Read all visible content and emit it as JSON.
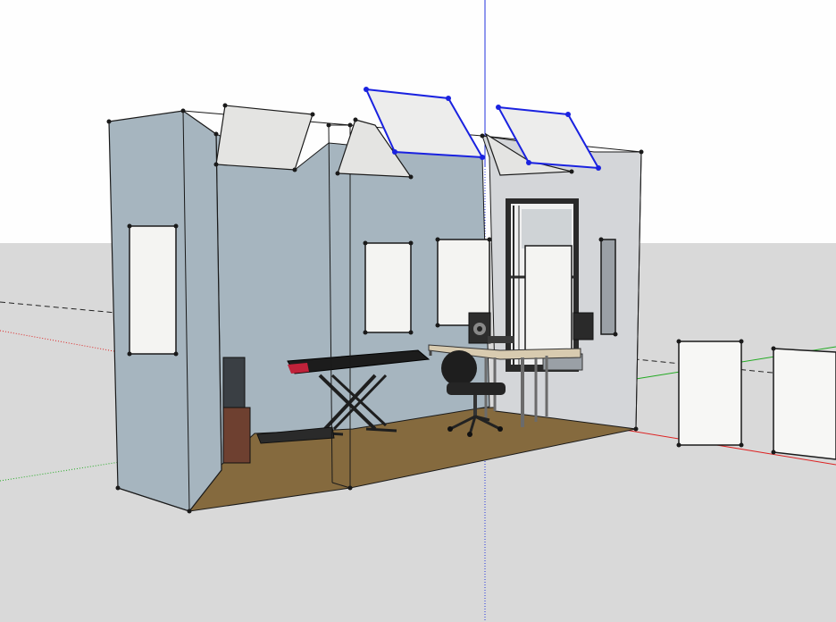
{
  "viewport": {
    "sky_color": "#fefefe",
    "ground_color": "#d9d9d9",
    "axis_colors": {
      "red": "#dd2222",
      "green": "#22aa22",
      "blue": "#2233dd"
    }
  },
  "model": {
    "wall_color": "#a6b5bf",
    "side_wall_color": "#d4d6d9",
    "floor_color": "#856a3e",
    "panel_color": "#f4f4f2",
    "ceiling_cloud_color": "#e4e4e2",
    "selection_color": "#1a22e0",
    "edge_color": "#1a1a1a",
    "speaker_color": "#6e4030",
    "desk_color": "#d8cbb0"
  }
}
